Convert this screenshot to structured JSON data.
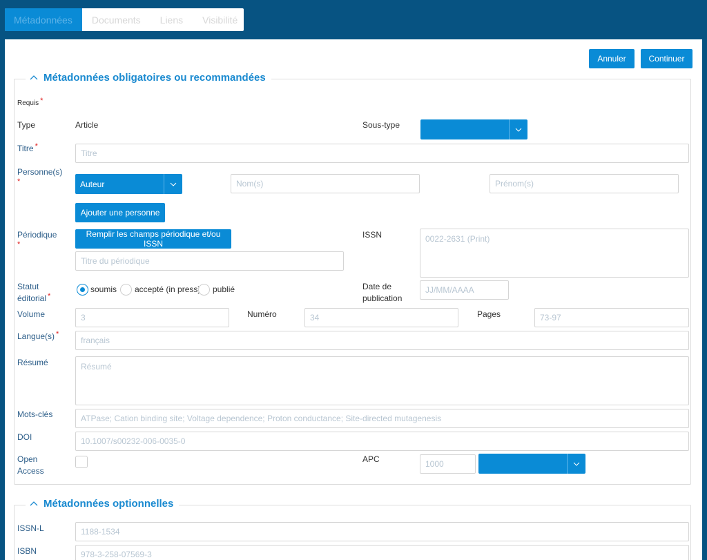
{
  "tabs": [
    {
      "label": "Métadonnées"
    },
    {
      "label": "Documents"
    },
    {
      "label": "Liens"
    },
    {
      "label": "Visibilité"
    }
  ],
  "actions": {
    "cancel": "Annuler",
    "continue": "Continuer"
  },
  "section_required": {
    "title": "Métadonnées obligatoires ou recommandées",
    "requis_label": "Requis",
    "type_label": "Type",
    "type_value": "Article",
    "subtype_label": "Sous-type",
    "subtype_value": "",
    "title_label": "Titre",
    "title_placeholder": "Titre",
    "persons_label": "Personne(s)",
    "role_value": "Auteur",
    "lastname_placeholder": "Nom(s)",
    "firstname_placeholder": "Prénom(s)",
    "add_person": "Ajouter une personne",
    "periodical_label": "Périodique",
    "fill_periodical": "Remplir les champs périodique et/ou ISSN",
    "periodical_title_placeholder": "Titre du périodique",
    "issn_label": "ISSN",
    "issn_placeholder": "0022-2631 (Print)",
    "status_label_1": "Statut",
    "status_label_2": "éditorial",
    "status_options": [
      "soumis",
      "accepté (in press)",
      "publié"
    ],
    "status_selected": "soumis",
    "pubdate_label_1": "Date de",
    "pubdate_label_2": "publication",
    "pubdate_placeholder": "JJ/MM/AAAA",
    "volume_label": "Volume",
    "volume_placeholder": "3",
    "number_label": "Numéro",
    "number_placeholder": "34",
    "pages_label": "Pages",
    "pages_placeholder": "73-97",
    "language_label": "Langue(s)",
    "language_placeholder": "français",
    "abstract_label": "Résumé",
    "abstract_placeholder": "Résumé",
    "keywords_label": "Mots-clés",
    "keywords_placeholder": "ATPase; Cation binding site; Voltage dependence; Proton conductance; Site-directed mutagenesis",
    "doi_label": "DOI",
    "doi_placeholder": "10.1007/s00232-006-0035-0",
    "oa_label_1": "Open",
    "oa_label_2": "Access",
    "apc_label": "APC",
    "apc_placeholder": "1000",
    "apc_currency": ""
  },
  "section_optional": {
    "title": "Métadonnées optionnelles",
    "issnl_label": "ISSN-L",
    "issnl_placeholder": "1188-1534",
    "isbn_label": "ISBN",
    "isbn_placeholder": "978-3-258-07569-3"
  },
  "colors": {
    "primary": "#0a8bd6",
    "background": "#075382",
    "required": "#e02020"
  },
  "icons": {
    "collapse": "chevron-up-icon",
    "dropdown": "chevron-down-icon"
  }
}
